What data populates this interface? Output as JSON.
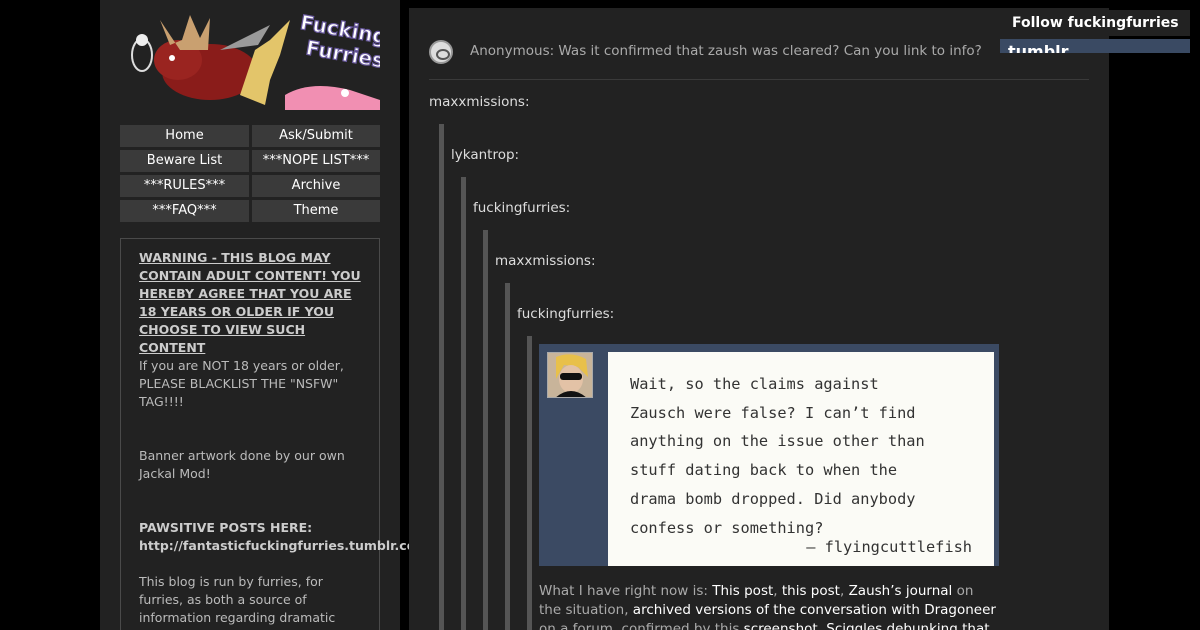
{
  "banner": {
    "title_line1": "Fucking",
    "title_line2": "Furries",
    "colors": {
      "moose": "#8a1c1a",
      "pink": "#f18fb2",
      "yellow": "#e3c56a",
      "outline": "#6a5aa0"
    }
  },
  "nav": {
    "items": [
      "Home",
      "Ask/Submit",
      "Beware List",
      "***NOPE LIST***",
      "***RULES***",
      "Archive",
      "***FAQ***",
      "Theme"
    ]
  },
  "description": {
    "warning": "WARNING - THIS BLOG MAY CONTAIN ADULT CONTENT! YOU HEREBY AGREE THAT YOU ARE 18 YEARS OR OLDER IF YOU CHOOSE TO VIEW SUCH CONTENT",
    "blacklist_note": "If you are NOT 18 years or older, PLEASE BLACKLIST THE \"NSFW\" TAG!!!!",
    "banner_credit": "Banner artwork done by our own Jackal Mod!",
    "pawsitive_heading": "PAWSITIVE POSTS HERE:",
    "pawsitive_link": "http://fantasticfuckingfurries.tumblr.com",
    "about": "This blog is run by furries, for furries, as both a source of information regarding dramatic"
  },
  "post": {
    "ask_text": "Anonymous: Was it confirmed that zaush was cleared? Can you link to info?",
    "attributions": [
      "maxxmissions:",
      "lykantrop:",
      "fuckingfurries:",
      "maxxmissions:",
      "fuckingfurries:"
    ],
    "quote_image": {
      "lines": [
        "Wait, so the claims against",
        "Zausch were false? I can’t find",
        "anything on the issue other than",
        "stuff dating back to when the",
        "drama bomb dropped. Did anybody",
        "confess or something?"
      ],
      "signature": "— flyingcuttlefish"
    },
    "body": {
      "intro": "What I have right now is: ",
      "link1": "This post",
      "sep1": ", ",
      "link2": "this post",
      "sep2": ", ",
      "link3": "Zaush’s journal",
      "mid1": " on the situation, ",
      "link4": "archived versions of the conversation with Dragoneer",
      "mid2": " on a forum, confirmed by this ",
      "link5": "screenshot",
      "sep3": ", ",
      "link6": "Sciggles debunking that Zaush"
    }
  },
  "follow": {
    "label": "Follow fuckingfurries",
    "tumblr": "tumblr"
  }
}
